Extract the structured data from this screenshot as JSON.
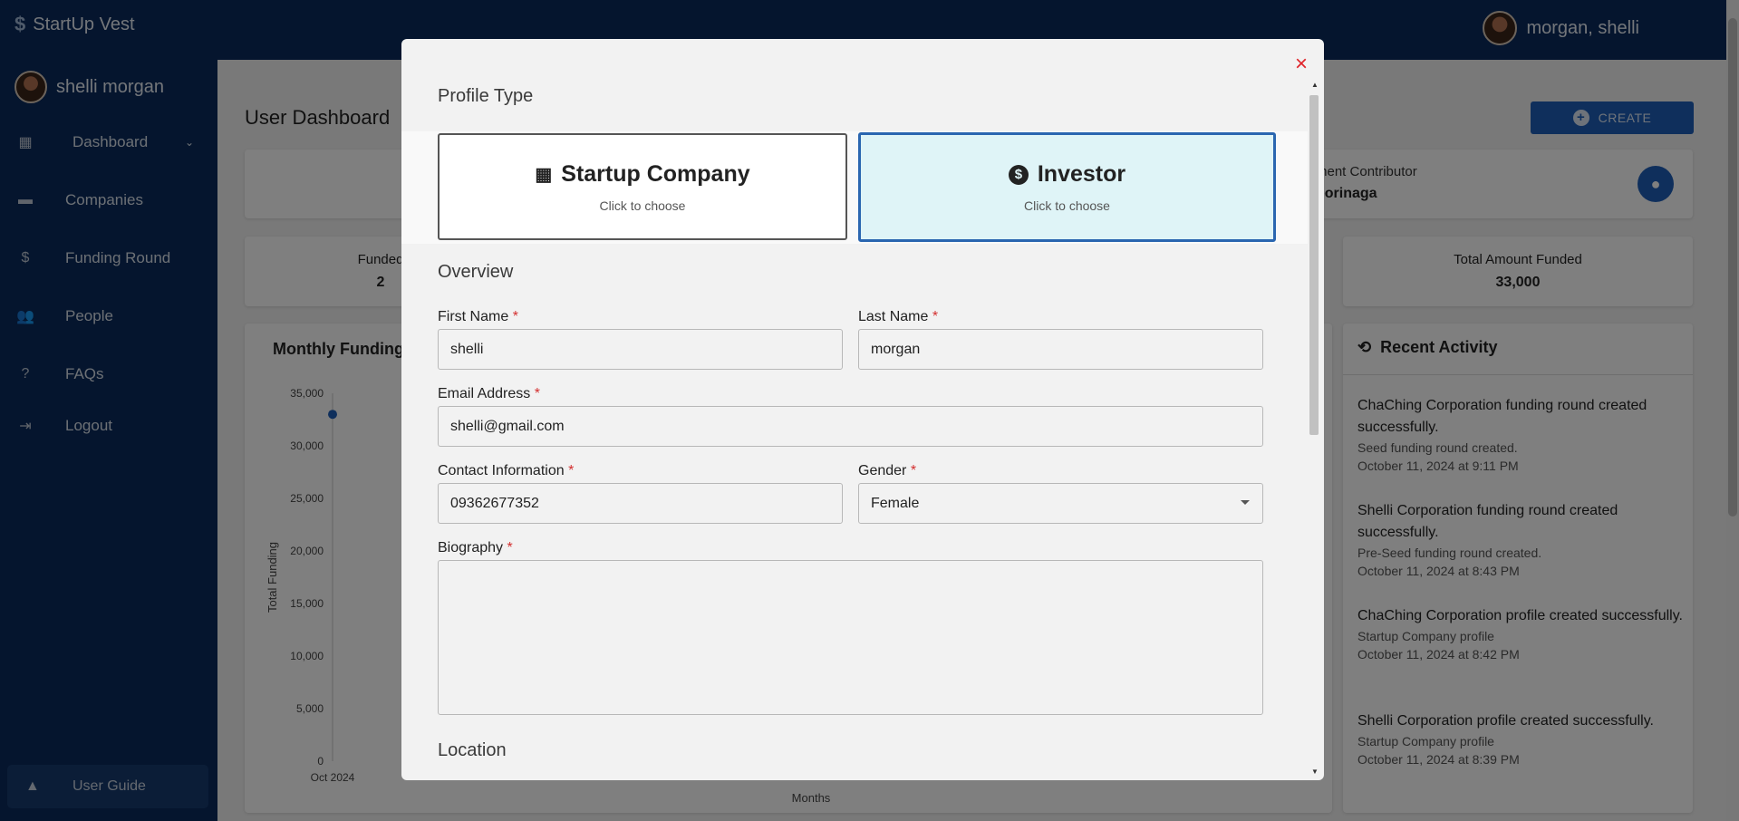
{
  "app": {
    "name": "StartUp Vest",
    "user_top": "morgan, shelli"
  },
  "sidebar": {
    "user": "shelli morgan",
    "items": [
      {
        "label": "Dashboard",
        "icon": "dashboard-icon"
      },
      {
        "label": "Companies",
        "icon": "store-icon"
      },
      {
        "label": "Funding Round",
        "icon": "dollar-icon"
      },
      {
        "label": "People",
        "icon": "people-icon"
      },
      {
        "label": "FAQs",
        "icon": "help-icon"
      },
      {
        "label": "Logout",
        "icon": "logout-icon"
      }
    ],
    "guide": "User Guide"
  },
  "dashboard": {
    "title": "User Dashboard",
    "create": "CREATE",
    "contributor_label": "ment Contributor",
    "contributor_value": "borinaga",
    "funded_label": "Funded",
    "funded_value": "2",
    "total_label": "Total Amount Funded",
    "total_value": "33,000",
    "chart_title": "Monthly Funding",
    "recent_title": "Recent Activity"
  },
  "chart_data": {
    "type": "line",
    "title": "Monthly Funding",
    "xlabel": "Months",
    "ylabel": "Total Funding",
    "categories": [
      "Oct 2024"
    ],
    "series": [
      {
        "values": [
          33000
        ]
      }
    ],
    "ylim": [
      0,
      35000
    ],
    "yticks": [
      "35,000",
      "30,000",
      "25,000",
      "20,000",
      "15,000",
      "10,000",
      "5,000",
      "0"
    ]
  },
  "activity": [
    {
      "title": "ChaChing Corporation funding round created successfully.",
      "sub": "Seed funding round created.",
      "time": "October 11, 2024 at 9:11 PM"
    },
    {
      "title": "Shelli Corporation funding round created successfully.",
      "sub": "Pre-Seed funding round created.",
      "time": "October 11, 2024 at 8:43 PM"
    },
    {
      "title": "ChaChing Corporation profile created successfully.",
      "sub": "Startup Company profile",
      "time": "October 11, 2024 at 8:42 PM"
    },
    {
      "title": "Shelli Corporation profile created successfully.",
      "sub": "Startup Company profile",
      "time": "October 11, 2024 at 8:39 PM"
    }
  ],
  "modal": {
    "close": "×",
    "profile_type": "Profile Type",
    "options": [
      {
        "title": "Startup Company",
        "sub": "Click to choose",
        "selected": false
      },
      {
        "title": "Investor",
        "sub": "Click to choose",
        "selected": true
      }
    ],
    "overview": "Overview",
    "first_name": {
      "label": "First Name",
      "value": "shelli"
    },
    "last_name": {
      "label": "Last Name",
      "value": "morgan"
    },
    "email": {
      "label": "Email Address",
      "value": "shelli@gmail.com"
    },
    "contact": {
      "label": "Contact Information",
      "value": "09362677352"
    },
    "gender": {
      "label": "Gender",
      "value": "Female"
    },
    "biography": {
      "label": "Biography",
      "value": ""
    },
    "required_mark": "*",
    "location": "Location"
  },
  "colors": {
    "navy": "#0a2a5c",
    "accent": "#2a66b0",
    "selected_bg": "#dff4f7",
    "required": "#d32f2f"
  }
}
